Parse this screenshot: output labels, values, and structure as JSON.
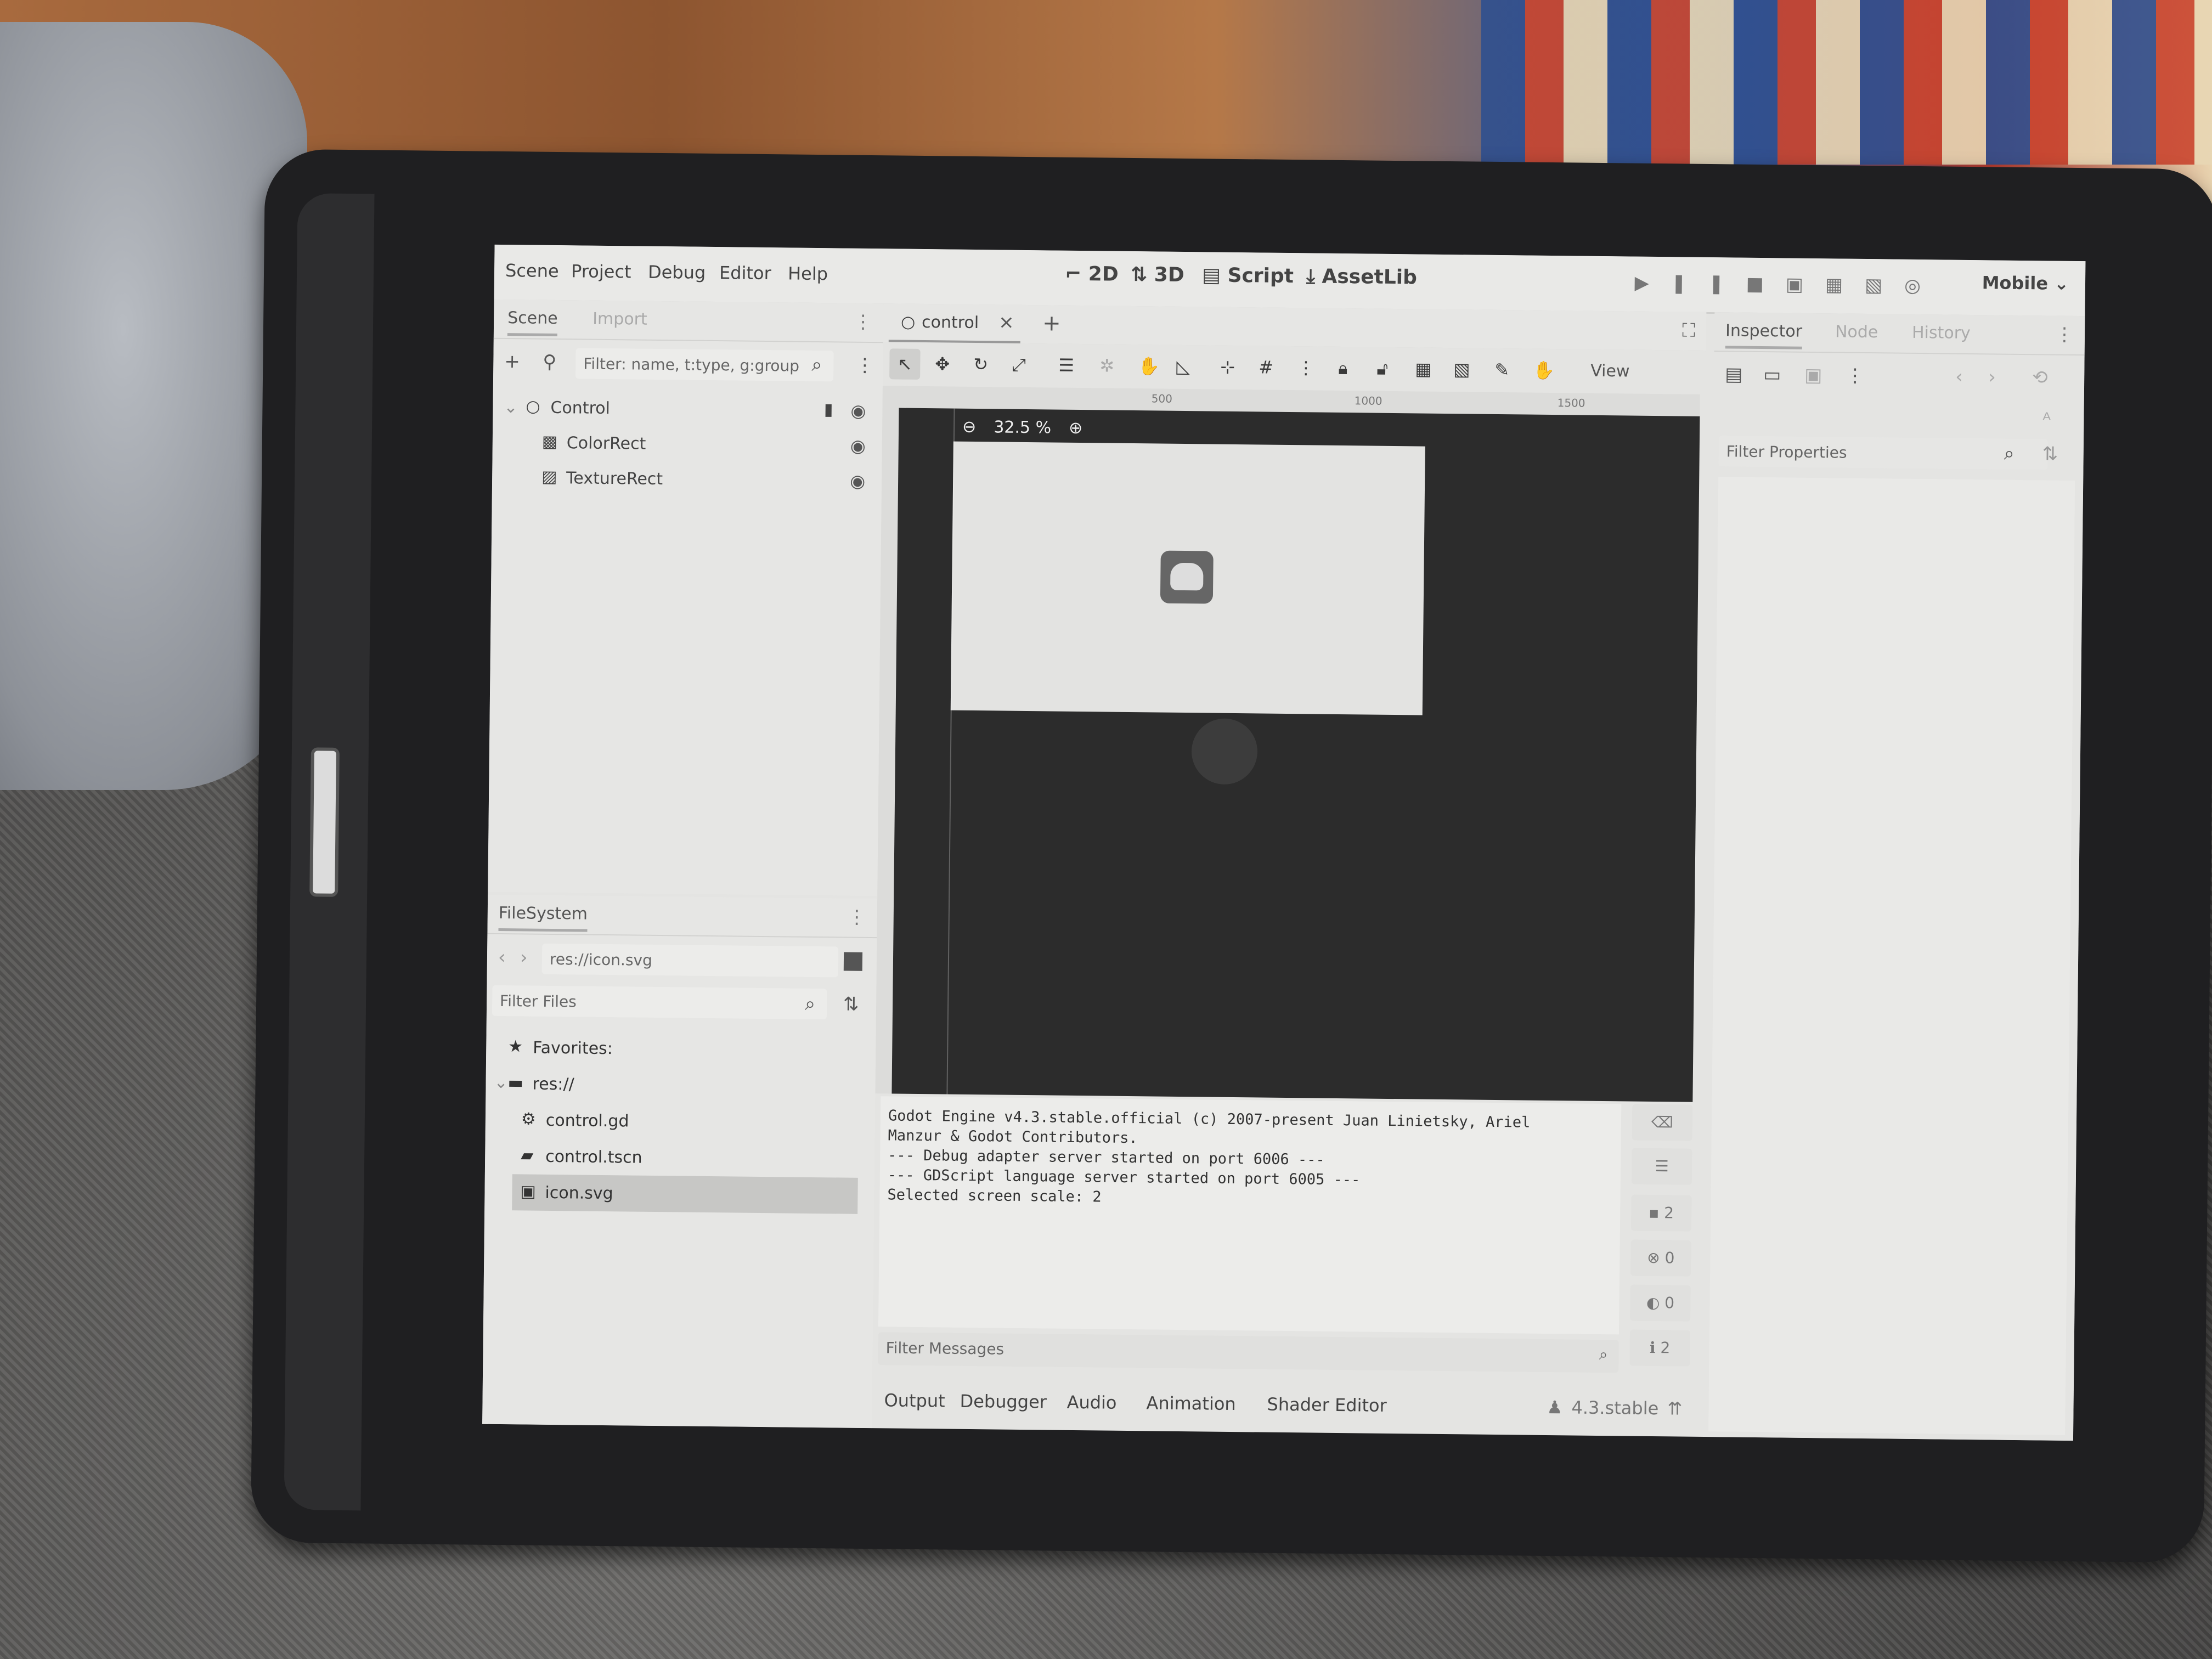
{
  "menu": {
    "items": [
      "Scene",
      "Project",
      "Debug",
      "Editor",
      "Help"
    ]
  },
  "workspaces": {
    "b2d": "2D",
    "b3d": "3D",
    "script": "Script",
    "assetlib": "AssetLib"
  },
  "renderer": "Mobile",
  "scene_dock": {
    "tab_scene": "Scene",
    "tab_import": "Import",
    "filter_placeholder": "Filter: name, t:type, g:group",
    "nodes": [
      {
        "label": "Control"
      },
      {
        "label": "ColorRect"
      },
      {
        "label": "TextureRect"
      }
    ]
  },
  "filesystem": {
    "title": "FileSystem",
    "path": "res://icon.svg",
    "filter_placeholder": "Filter Files",
    "favorites": "Favorites:",
    "root": "res://",
    "files": [
      {
        "label": "control.gd"
      },
      {
        "label": "control.tscn"
      },
      {
        "label": "icon.svg"
      }
    ]
  },
  "editor": {
    "scene_tab": "control",
    "view_button": "View",
    "zoom": "32.5 %",
    "ruler_marks": [
      "500",
      "1000",
      "1500"
    ]
  },
  "output": {
    "lines": [
      "Godot Engine v4.3.stable.official (c) 2007-present Juan Linietsky, Ariel",
      "Manzur & Godot Contributors.",
      "--- Debug adapter server started on port 6006 ---",
      "--- GDScript language server started on port 6005 ---",
      "Selected screen scale:  2"
    ],
    "filter_placeholder": "Filter Messages",
    "counts": {
      "messages": "2",
      "errors": "0",
      "warnings": "0",
      "info": "2"
    }
  },
  "bottom_panel": {
    "tabs": [
      "Output",
      "Debugger",
      "Audio",
      "Animation",
      "Shader Editor"
    ],
    "version": "4.3.stable"
  },
  "inspector": {
    "tab_inspector": "Inspector",
    "tab_node": "Node",
    "tab_history": "History",
    "filter_placeholder": "Filter Properties"
  }
}
